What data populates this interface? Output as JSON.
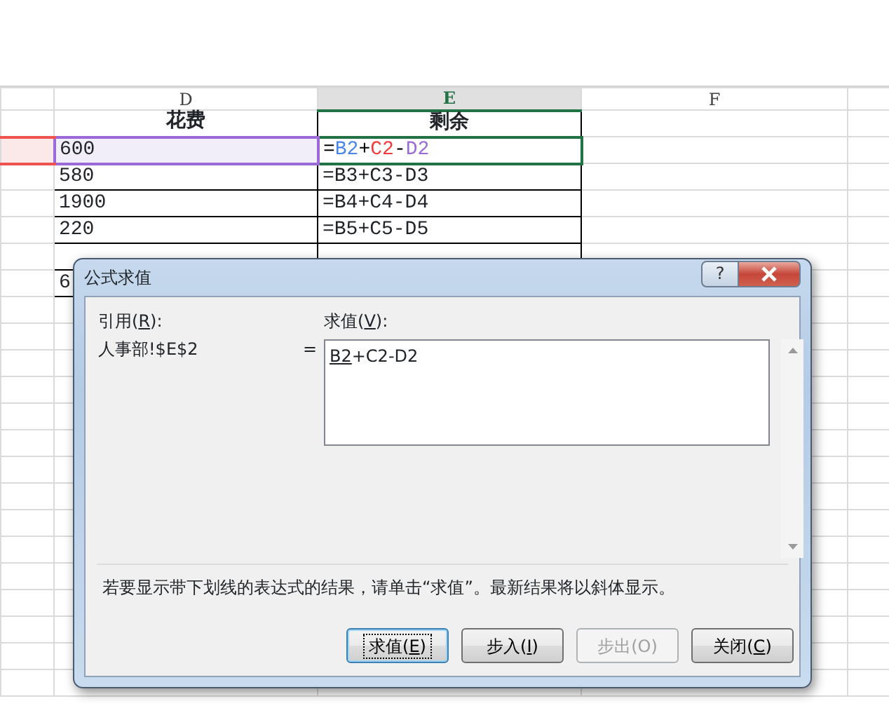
{
  "sheet": {
    "columns": [
      {
        "label": "D",
        "selected": false
      },
      {
        "label": "E",
        "selected": true
      },
      {
        "label": "F",
        "selected": false
      }
    ],
    "rows": [
      {
        "kind": "header",
        "d": "花费",
        "e": "剩余"
      },
      {
        "kind": "data",
        "active": true,
        "c_referenced": true,
        "d_referenced": true,
        "d": "600",
        "e_parts": [
          {
            "text": "=",
            "color": "#000000"
          },
          {
            "text": "B2",
            "color": "#4a86e8"
          },
          {
            "text": "+",
            "color": "#000000"
          },
          {
            "text": "C2",
            "color": "#ef3b3b"
          },
          {
            "text": "-",
            "color": "#000000"
          },
          {
            "text": "D2",
            "color": "#9b6ad6"
          }
        ]
      },
      {
        "kind": "data",
        "d": "580",
        "e": "=B3+C3-D3"
      },
      {
        "kind": "data",
        "d": "1900",
        "e": "=B4+C4-D4"
      },
      {
        "kind": "data",
        "d": "220",
        "e": "=B5+C5-D5"
      },
      {
        "kind": "data"
      },
      {
        "kind": "data",
        "d": "6"
      }
    ]
  },
  "dialog": {
    "title": "公式求值",
    "help": "?",
    "reference_label": [
      "引用(",
      "R",
      "):"
    ],
    "reference": "人事部!$E$2",
    "equals": "=",
    "evaluation_label": [
      "求值(",
      "V",
      "):"
    ],
    "evaluation": [
      {
        "text": "B2",
        "underlined": true
      },
      {
        "text": "+C2-D2",
        "underlined": false
      }
    ],
    "message": "若要显示带下划线的表达式的结果，请单击“求值”。最新结果将以斜体显示。",
    "buttons": [
      {
        "parts": [
          "求值(",
          "E",
          ")"
        ],
        "disabled": false,
        "focused": true
      },
      {
        "parts": [
          "步入(",
          "I",
          ")"
        ],
        "disabled": false,
        "focused": false
      },
      {
        "parts": [
          "步出(O)"
        ],
        "disabled": true,
        "focused": false
      },
      {
        "parts": [
          "关闭(",
          "C",
          ")"
        ],
        "disabled": false,
        "focused": false
      }
    ]
  }
}
